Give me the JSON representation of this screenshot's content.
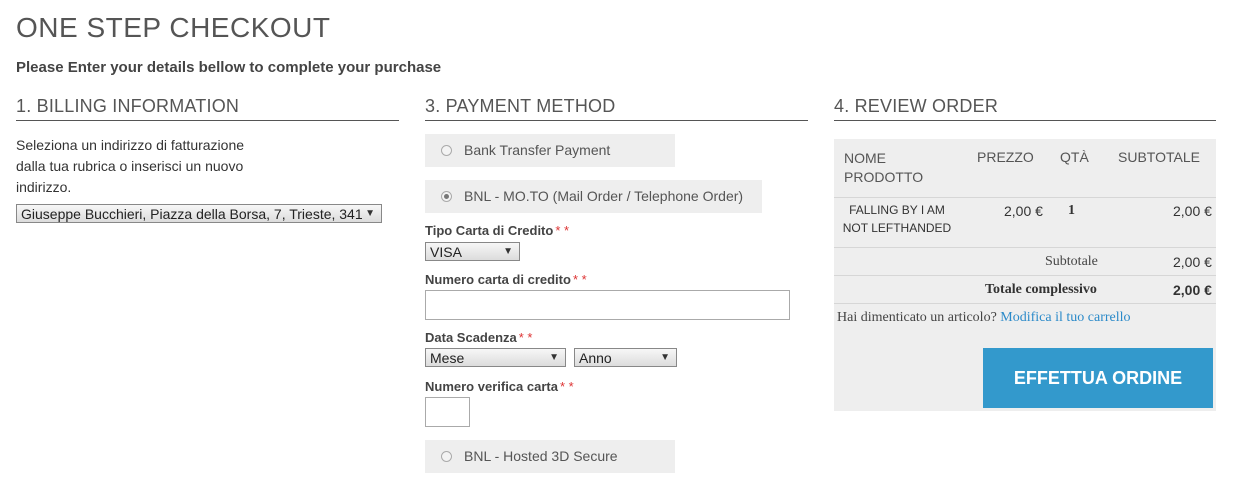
{
  "header": {
    "title": "ONE STEP CHECKOUT",
    "subtitle": "Please Enter your details bellow to complete your purchase"
  },
  "billing": {
    "section_title": "1. BILLING INFORMATION",
    "instructions": "Seleziona un indirizzo di fatturazione dalla tua rubrica o inserisci un nuovo indirizzo.",
    "address_selected": "Giuseppe Bucchieri, Piazza della Borsa, 7, Trieste, 341"
  },
  "payment": {
    "section_title": "3. PAYMENT METHOD",
    "methods": [
      {
        "label": "Bank Transfer Payment",
        "checked": false
      },
      {
        "label": "BNL - MO.TO (Mail Order / Telephone Order)",
        "checked": true
      },
      {
        "label": "BNL - Hosted 3D Secure",
        "checked": false
      }
    ],
    "card_type_label": "Tipo Carta di Credito",
    "card_type_value": "VISA",
    "card_number_label": "Numero carta di credito",
    "card_number_value": "",
    "expiry_label": "Data Scadenza",
    "expiry_month": "Mese",
    "expiry_year": "Anno",
    "cvv_label": "Numero verifica carta",
    "cvv_value": "",
    "required_marker": "* *"
  },
  "review": {
    "section_title": "4. REVIEW ORDER",
    "columns": {
      "name": "NOME PRODOTTO",
      "price": "PREZZO",
      "qty": "QTÀ",
      "subtotal": "SUBTOTALE"
    },
    "items": [
      {
        "name": "FALLING BY I AM NOT LEFTHANDED",
        "price": "2,00 €",
        "qty": "1",
        "subtotal": "2,00 €"
      }
    ],
    "subtotal_label": "Subtotale",
    "subtotal_value": "2,00 €",
    "total_label": "Totale complessivo",
    "total_value": "2,00 €",
    "forgot_text": "Hai dimenticato un articolo?",
    "edit_cart_link": "Modifica il tuo carrello",
    "place_order_button": "EFFETTUA ORDINE"
  },
  "colors": {
    "accent": "#3399cc",
    "link": "#2b8ac9",
    "required": "#dd3333",
    "panel": "#eeeeee"
  }
}
